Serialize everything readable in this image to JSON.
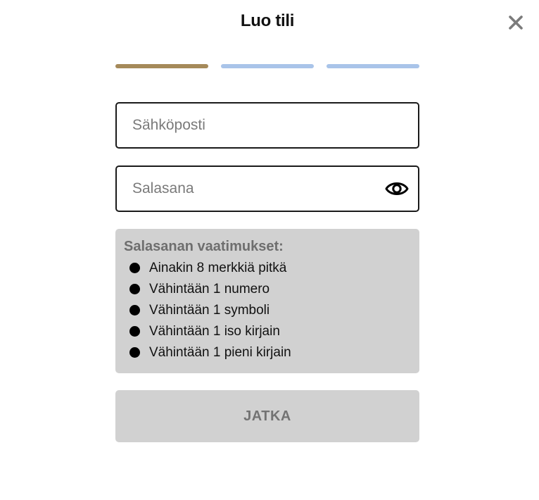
{
  "header": {
    "title": "Luo tili",
    "close_icon": "close-icon"
  },
  "steps": {
    "current": 1,
    "total": 3,
    "colors": {
      "active": "#a58a5a",
      "inactive": "#a9c4e9"
    }
  },
  "form": {
    "email": {
      "placeholder": "Sähköposti",
      "value": ""
    },
    "password": {
      "placeholder": "Salasana",
      "value": "",
      "toggle_icon": "eye-icon"
    }
  },
  "requirements": {
    "title": "Salasanan vaatimukset:",
    "items": [
      "Ainakin 8 merkkiä pitkä",
      "Vähintään 1 numero",
      "Vähintään 1 symboli",
      "Vähintään 1 iso kirjain",
      "Vähintään 1 pieni kirjain"
    ]
  },
  "actions": {
    "continue_label": "JATKA"
  }
}
